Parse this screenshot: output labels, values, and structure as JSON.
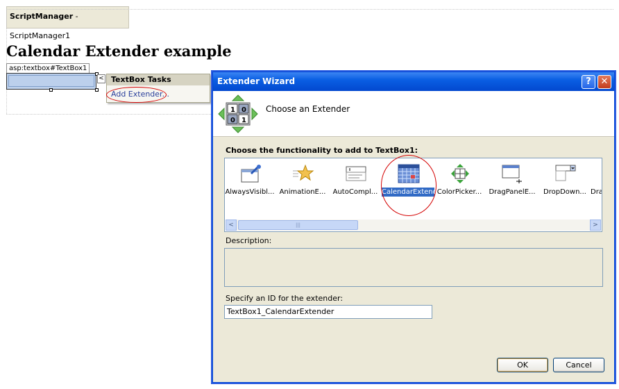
{
  "designer": {
    "script_manager": {
      "type": "ScriptManager",
      "name": " - ScriptManager1"
    },
    "page_heading": "Calendar Extender example",
    "textbox_tag": "asp:textbox#TextBox1",
    "smart_tag_glyph": "<",
    "tasks_panel": {
      "title": "TextBox Tasks",
      "link": "Add Extender..."
    }
  },
  "dialog": {
    "title": "Extender Wizard",
    "help_glyph": "?",
    "close_glyph": "✕",
    "header": "Choose an Extender",
    "choose_label": "Choose the functionality to add to TextBox1:",
    "extenders": [
      {
        "label": "AlwaysVisibl...",
        "icon": "pushpin-icon"
      },
      {
        "label": "AnimationE...",
        "icon": "star-animation-icon"
      },
      {
        "label": "AutoCompl...",
        "icon": "autocomplete-icon"
      },
      {
        "label": "CalendarExtender",
        "icon": "calendar-icon",
        "selected": true
      },
      {
        "label": "ColorPicker...",
        "icon": "colorpicker-icon"
      },
      {
        "label": "DragPanelE...",
        "icon": "drag-panel-icon"
      },
      {
        "label": "DropDown...",
        "icon": "dropdown-icon"
      },
      {
        "label": "Dra",
        "icon": "partial-icon"
      }
    ],
    "scroll_left": "<",
    "scroll_right": ">",
    "scroll_grip": "|||",
    "description_label": "Description:",
    "description_text": "",
    "id_label": "Specify an ID for the extender:",
    "id_value": "TextBox1_CalendarExtender",
    "ok_label": "OK",
    "cancel_label": "Cancel"
  },
  "colors": {
    "title_bar": "#0a5fe3",
    "selection": "#316ac5",
    "highlight_circle": "#d40000",
    "dialog_bg": "#ece9d8"
  }
}
